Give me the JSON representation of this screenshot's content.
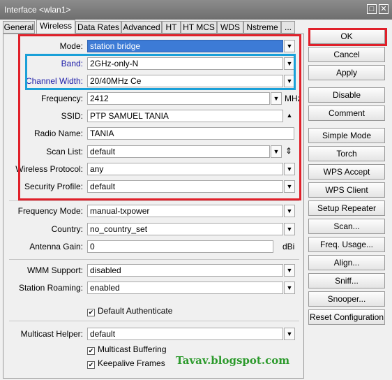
{
  "window": {
    "title": "Interface <wlan1>",
    "maximize_icon": "□",
    "close_icon": "✕"
  },
  "tabs": [
    "General",
    "Wireless",
    "Data Rates",
    "Advanced",
    "HT",
    "HT MCS",
    "WDS",
    "Nstreme",
    "..."
  ],
  "active_tab": "Wireless",
  "fields": {
    "mode": {
      "label": "Mode:",
      "value": "station bridge"
    },
    "band": {
      "label": "Band:",
      "value": "2GHz-only-N"
    },
    "channel_width": {
      "label": "Channel Width:",
      "value": "20/40MHz Ce"
    },
    "frequency": {
      "label": "Frequency:",
      "value": "2412",
      "unit": "MHz"
    },
    "ssid": {
      "label": "SSID:",
      "value": "PTP SAMUEL TANIA"
    },
    "radio_name": {
      "label": "Radio Name:",
      "value": "TANIA"
    },
    "scan_list": {
      "label": "Scan List:",
      "value": "default"
    },
    "wireless_protocol": {
      "label": "Wireless Protocol:",
      "value": "any"
    },
    "security_profile": {
      "label": "Security Profile:",
      "value": "default"
    },
    "frequency_mode": {
      "label": "Frequency Mode:",
      "value": "manual-txpower"
    },
    "country": {
      "label": "Country:",
      "value": "no_country_set"
    },
    "antenna_gain": {
      "label": "Antenna Gain:",
      "value": "0",
      "unit": "dBi"
    },
    "wmm_support": {
      "label": "WMM Support:",
      "value": "disabled"
    },
    "station_roaming": {
      "label": "Station Roaming:",
      "value": "enabled"
    },
    "multicast_helper": {
      "label": "Multicast Helper:",
      "value": "default"
    }
  },
  "checkboxes": {
    "default_authenticate": {
      "label": "Default Authenticate",
      "checked": true
    },
    "multicast_buffering": {
      "label": "Multicast Buffering",
      "checked": true
    },
    "keepalive_frames": {
      "label": "Keepalive Frames",
      "checked": true
    }
  },
  "check_glyph": "✔",
  "dropdown_glyph": "▼",
  "up_glyph": "▲",
  "updown_glyph": "⇕",
  "buttons": [
    "OK",
    "Cancel",
    "Apply",
    "Disable",
    "Comment",
    "Simple Mode",
    "Torch",
    "WPS Accept",
    "WPS Client",
    "Setup Repeater",
    "Scan...",
    "Freq. Usage...",
    "Align...",
    "Sniff...",
    "Snooper...",
    "Reset Configuration"
  ],
  "watermark": "Tavav.blogspot.com",
  "colors": {
    "highlight_red": "#e0202a",
    "highlight_blue": "#1aa0d8",
    "selection": "#3d7bd6",
    "watermark": "#2c9a2c"
  }
}
